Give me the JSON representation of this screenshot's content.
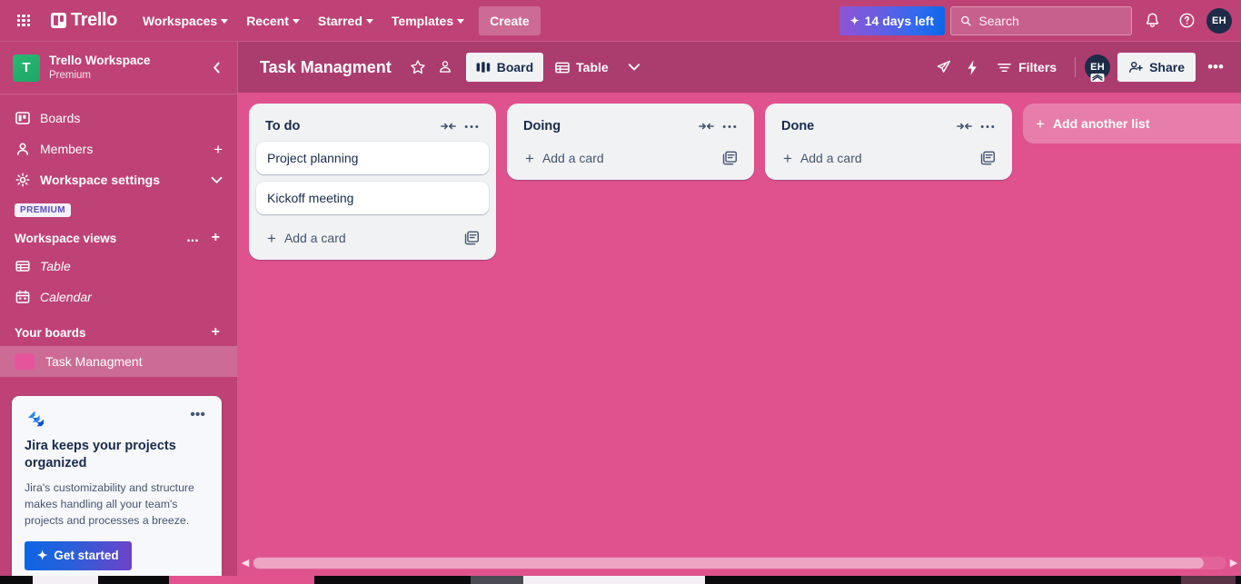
{
  "topnav": {
    "apps_icon": "grid-apps-icon",
    "logo_text": "Trello",
    "items": [
      {
        "label": "Workspaces"
      },
      {
        "label": "Recent"
      },
      {
        "label": "Starred"
      },
      {
        "label": "Templates"
      }
    ],
    "create_label": "Create",
    "trial_label": "14 days left",
    "search_placeholder": "Search",
    "search_value": "",
    "notifications_icon": "bell-icon",
    "help_icon": "help-circle-icon",
    "avatar_initials": "EH"
  },
  "sidebar": {
    "workspace_name": "Trello Workspace",
    "workspace_plan": "Premium",
    "workspace_initial": "T",
    "collapse_icon": "chevron-left-icon",
    "nav": [
      {
        "label": "Boards",
        "icon": "board-icon",
        "end": ""
      },
      {
        "label": "Members",
        "icon": "person-icon",
        "end": "+"
      },
      {
        "label": "Workspace settings",
        "icon": "gear-icon",
        "end": "v"
      }
    ],
    "premium_pill": "PREMIUM",
    "views_heading": "Workspace views",
    "views_more": "...",
    "views_add": "+",
    "views": [
      {
        "label": "Table",
        "icon": "table-icon"
      },
      {
        "label": "Calendar",
        "icon": "calendar-icon"
      }
    ],
    "boards_heading": "Your boards",
    "boards_add": "+",
    "boards": [
      {
        "label": "Task Managment",
        "color": "#E6559B",
        "active": true
      }
    ]
  },
  "promo": {
    "logo_icon": "jira-logo-icon",
    "more_icon": "more-horizontal-icon",
    "title": "Jira keeps your projects organized",
    "body": "Jira's customizability and structure makes handling all your team's projects and processes a breeze.",
    "button_label": "Get started"
  },
  "board_header": {
    "title": "Task Managment",
    "star_icon": "star-outline-icon",
    "visibility_icon": "workspace-visible-icon",
    "tabs": [
      {
        "label": "Board",
        "icon": "board-view-icon",
        "active": true
      },
      {
        "label": "Table",
        "icon": "table-view-icon",
        "active": false
      }
    ],
    "tabs_chevron": "chevron-down-icon",
    "rocket_icon": "rocket-icon",
    "automation_icon": "lightning-bolt-icon",
    "filters_label": "Filters",
    "filters_icon": "filter-icon",
    "member_initials": "EH",
    "member_badge": "admin-badge",
    "share_label": "Share",
    "share_icon": "person-add-icon",
    "more_icon": "more-horizontal-icon"
  },
  "board": {
    "background_color": "#DF528D",
    "lists": [
      {
        "title": "To do",
        "collapse_icon": "collapse-list-icon",
        "more_icon": "more-horizontal-icon",
        "cards": [
          {
            "title": "Project planning"
          },
          {
            "title": "Kickoff meeting"
          }
        ],
        "add_card_label": "Add a card",
        "template_icon": "card-template-icon"
      },
      {
        "title": "Doing",
        "collapse_icon": "collapse-list-icon",
        "more_icon": "more-horizontal-icon",
        "cards": [],
        "add_card_label": "Add a card",
        "template_icon": "card-template-icon"
      },
      {
        "title": "Done",
        "collapse_icon": "collapse-list-icon",
        "more_icon": "more-horizontal-icon",
        "cards": [],
        "add_card_label": "Add a card",
        "template_icon": "card-template-icon"
      }
    ],
    "add_list_label": "Add another list",
    "scroll_left_icon": "chevron-left-icon",
    "scroll_right_icon": "chevron-right-icon"
  }
}
